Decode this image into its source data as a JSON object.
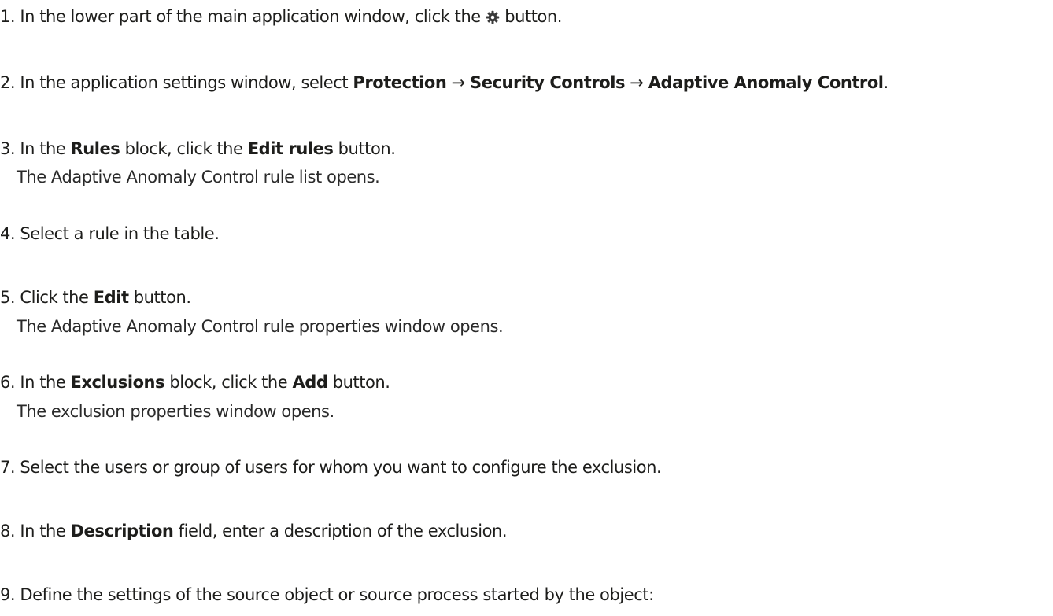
{
  "steps": [
    {
      "number": "1.",
      "parts": [
        "In the lower part of the main application window, click the ",
        " button."
      ],
      "icon": "gear-icon"
    },
    {
      "number": "2.",
      "text_pre": "In the application settings window, select ",
      "path": [
        "Protection",
        "Security Controls",
        "Adaptive Anomaly Control"
      ],
      "arrow": "→",
      "text_post": "."
    },
    {
      "number": "3.",
      "pre": "In the ",
      "b1": "Rules",
      "mid": " block, click the ",
      "b2": "Edit rules",
      "post": " button.",
      "result": "The Adaptive Anomaly Control rule list opens."
    },
    {
      "number": "4.",
      "text": "Select a rule in the table."
    },
    {
      "number": "5.",
      "pre": "Click the ",
      "b1": "Edit",
      "post": " button.",
      "result": "The Adaptive Anomaly Control rule properties window opens."
    },
    {
      "number": "6.",
      "pre": "In the ",
      "b1": "Exclusions",
      "mid": " block, click the ",
      "b2": "Add",
      "post": " button.",
      "result": "The exclusion properties window opens."
    },
    {
      "number": "7.",
      "text": "Select the users or group of users for whom you want to configure the exclusion."
    },
    {
      "number": "8.",
      "pre": "In the ",
      "b1": "Description",
      "post": " field, enter a description of the exclusion."
    },
    {
      "number": "9.",
      "text": "Define the settings of the source object or source process started by the object:"
    }
  ]
}
